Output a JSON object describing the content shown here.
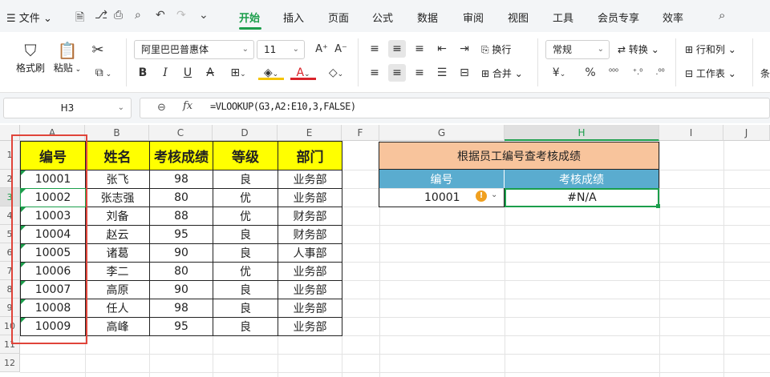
{
  "menubar": {
    "file_label": "文件",
    "tabs": [
      {
        "label": "开始",
        "active": true
      },
      {
        "label": "插入"
      },
      {
        "label": "页面"
      },
      {
        "label": "公式"
      },
      {
        "label": "数据"
      },
      {
        "label": "审阅"
      },
      {
        "label": "视图"
      },
      {
        "label": "工具"
      },
      {
        "label": "会员专享"
      },
      {
        "label": "效率"
      }
    ]
  },
  "ribbon": {
    "format_painter": "格式刷",
    "paste": "粘贴",
    "font_name": "阿里巴巴普惠体",
    "font_size": "11",
    "wrap_text": "换行",
    "number_format": "常规",
    "convert": "转换",
    "merge": "合并",
    "rows_cols": "行和列",
    "worksheet": "工作表",
    "cond_format_partial": "条",
    "pct": "%"
  },
  "formula_bar": {
    "name_box": "H3",
    "fx": "fx",
    "formula": "=VLOOKUP(G3,A2:E10,3,FALSE)"
  },
  "columns": [
    "A",
    "B",
    "C",
    "D",
    "E",
    "F",
    "G",
    "H",
    "I",
    "J"
  ],
  "rows": [
    "1",
    "2",
    "3",
    "4",
    "5",
    "6",
    "7",
    "8",
    "9",
    "10",
    "11",
    "12"
  ],
  "table": {
    "headers": [
      "编号",
      "姓名",
      "考核成绩",
      "等级",
      "部门"
    ],
    "rows": [
      [
        "10001",
        "张飞",
        "98",
        "良",
        "业务部"
      ],
      [
        "10002",
        "张志强",
        "80",
        "优",
        "业务部"
      ],
      [
        "10003",
        "刘备",
        "88",
        "优",
        "财务部"
      ],
      [
        "10004",
        "赵云",
        "95",
        "良",
        "财务部"
      ],
      [
        "10005",
        "诸葛",
        "90",
        "良",
        "人事部"
      ],
      [
        "10006",
        "李二",
        "80",
        "优",
        "业务部"
      ],
      [
        "10007",
        "高原",
        "90",
        "良",
        "业务部"
      ],
      [
        "10008",
        "任人",
        "98",
        "良",
        "业务部"
      ],
      [
        "10009",
        "高峰",
        "95",
        "良",
        "业务部"
      ]
    ]
  },
  "lookup": {
    "title": "根据员工编号查考核成绩",
    "col_headers": [
      "编号",
      "考核成绩"
    ],
    "input_value": "10001",
    "result_value": "#N/A"
  },
  "colors": {
    "accent": "#1b9e4b",
    "yellow": "#ffff00",
    "peach": "#f8c49c",
    "teal": "#5aaccf",
    "red_box": "#e0443a"
  }
}
